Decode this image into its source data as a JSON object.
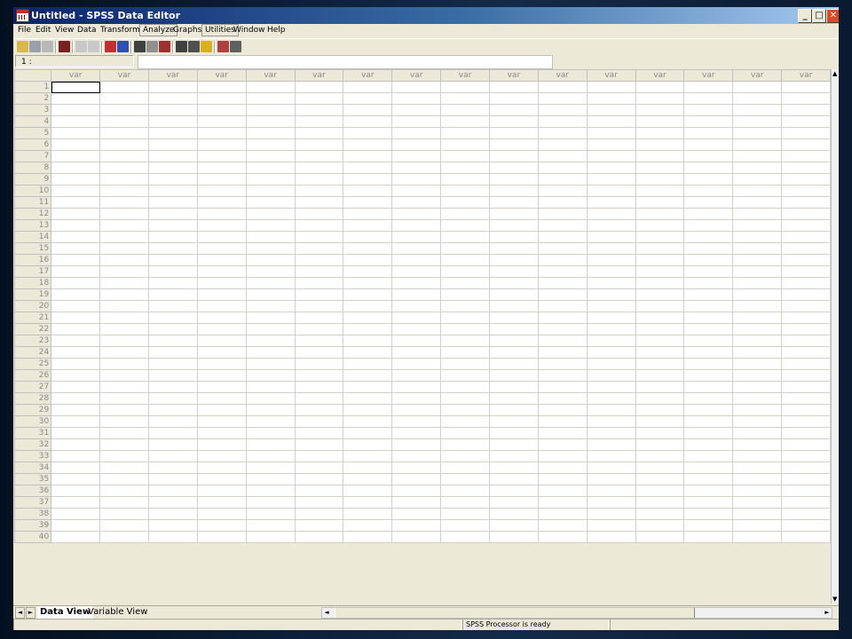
{
  "window": {
    "title": "Untitled - SPSS Data Editor"
  },
  "menu": [
    "File",
    "Edit",
    "View",
    "Data",
    "Transform",
    "Analyze",
    "Graphs",
    "Utilities",
    "Window",
    "Help"
  ],
  "toolbar": {
    "icons": [
      "open-icon",
      "save-icon",
      "print-icon",
      "dialog-recall-icon",
      "undo-icon",
      "redo-icon",
      "goto-chart-icon",
      "goto-case-icon",
      "variables-icon",
      "find-icon",
      "insert-cases-icon",
      "insert-variable-icon",
      "split-file-icon",
      "weight-cases-icon",
      "select-cases-icon",
      "value-labels-icon",
      "use-sets-icon"
    ]
  },
  "cellbar": {
    "ref": "1 :",
    "value": ""
  },
  "grid": {
    "column_header": "var",
    "column_count": 16,
    "row_count": 40,
    "active_cell": {
      "row": 1,
      "col": 1
    }
  },
  "tabs": {
    "data_view": "Data View",
    "variable_view": "Variable View"
  },
  "nav": {
    "left": "◄",
    "right": "►"
  },
  "status": {
    "processor": "SPSS Processor  is ready"
  },
  "colors": {
    "title_start": "#0a246a",
    "title_end": "#a6caf0",
    "chrome": "#ece9d8",
    "grid_line": "#d4d0c8"
  }
}
